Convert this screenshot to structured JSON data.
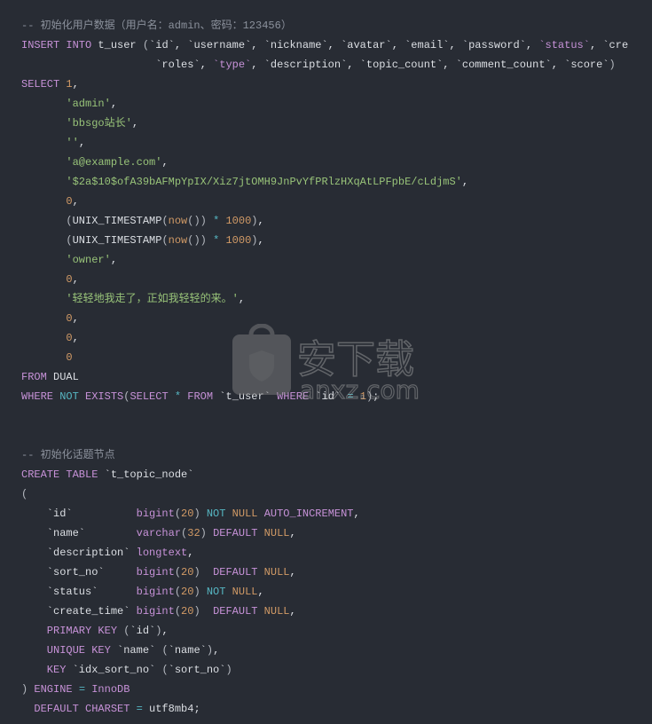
{
  "colors": {
    "background": "#282c34",
    "keyword": "#c792d8",
    "string": "#98c379",
    "number": "#d19a66",
    "operator": "#56b6c2",
    "comment": "#8b919c",
    "text": "#dcdfe4"
  },
  "watermark": {
    "text": "安下载",
    "domain": "anxz.com",
    "glyph": "安"
  },
  "lines": [
    [
      [
        "cm",
        "-- 初始化用户数据（用户名：admin、密码：123456）"
      ]
    ],
    [
      [
        "kw",
        "INSERT INTO "
      ],
      [
        "id",
        "t_user "
      ],
      [
        "pn",
        "("
      ],
      [
        "id",
        "`id`, `username`, `nickname`, `avatar`, `email`, `password`, "
      ],
      [
        "kw",
        "`status`"
      ],
      [
        "id",
        ", `cre"
      ]
    ],
    [
      [
        "id",
        "                     `roles`, "
      ],
      [
        "kw",
        "`type`"
      ],
      [
        "id",
        ", `description`, `topic_count`, `comment_count`, `score`"
      ],
      [
        "pn",
        ")"
      ]
    ],
    [
      [
        "kw",
        "SELECT "
      ],
      [
        "num",
        "1"
      ],
      [
        "id",
        ","
      ]
    ],
    [
      [
        "str",
        "       'admin'"
      ],
      [
        "id",
        ","
      ]
    ],
    [
      [
        "str",
        "       'bbsgo站长'"
      ],
      [
        "id",
        ","
      ]
    ],
    [
      [
        "str",
        "       ''"
      ],
      [
        "id",
        ","
      ]
    ],
    [
      [
        "str",
        "       'a@example.com'"
      ],
      [
        "id",
        ","
      ]
    ],
    [
      [
        "str",
        "       '$2a$10$ofA39bAFMpYpIX/Xiz7jtOMH9JnPvYfPRlzHXqAtLPFpbE/cLdjmS'"
      ],
      [
        "id",
        ","
      ]
    ],
    [
      [
        "num",
        "       0"
      ],
      [
        "id",
        ","
      ]
    ],
    [
      [
        "pn",
        "       ("
      ],
      [
        "id",
        "UNIX_TIMESTAMP"
      ],
      [
        "pn",
        "("
      ],
      [
        "num",
        "now"
      ],
      [
        "pn",
        "()) "
      ],
      [
        "op",
        "* "
      ],
      [
        "num",
        "1000"
      ],
      [
        "pn",
        ")"
      ],
      [
        "id",
        ","
      ]
    ],
    [
      [
        "pn",
        "       ("
      ],
      [
        "id",
        "UNIX_TIMESTAMP"
      ],
      [
        "pn",
        "("
      ],
      [
        "num",
        "now"
      ],
      [
        "pn",
        "()) "
      ],
      [
        "op",
        "* "
      ],
      [
        "num",
        "1000"
      ],
      [
        "pn",
        ")"
      ],
      [
        "id",
        ","
      ]
    ],
    [
      [
        "str",
        "       'owner'"
      ],
      [
        "id",
        ","
      ]
    ],
    [
      [
        "num",
        "       0"
      ],
      [
        "id",
        ","
      ]
    ],
    [
      [
        "str",
        "       '轻轻地我走了，正如我轻轻的来。'"
      ],
      [
        "id",
        ","
      ]
    ],
    [
      [
        "num",
        "       0"
      ],
      [
        "id",
        ","
      ]
    ],
    [
      [
        "num",
        "       0"
      ],
      [
        "id",
        ","
      ]
    ],
    [
      [
        "num",
        "       0"
      ]
    ],
    [
      [
        "kw",
        "FROM "
      ],
      [
        "id",
        "DUAL"
      ]
    ],
    [
      [
        "kw",
        "WHERE "
      ],
      [
        "op",
        "NOT "
      ],
      [
        "kw",
        "EXISTS"
      ],
      [
        "pn",
        "("
      ],
      [
        "kw",
        "SELECT "
      ],
      [
        "op",
        "* "
      ],
      [
        "kw",
        "FROM "
      ],
      [
        "id",
        "`t_user` "
      ],
      [
        "kw",
        "WHERE "
      ],
      [
        "id",
        "`id` "
      ],
      [
        "op",
        "= "
      ],
      [
        "num",
        "1"
      ],
      [
        "pn",
        ")"
      ],
      [
        "id",
        ";"
      ]
    ],
    [],
    [],
    [
      [
        "cm",
        "-- 初始化话题节点"
      ]
    ],
    [
      [
        "kw",
        "CREATE TABLE "
      ],
      [
        "id",
        "`t_topic_node`"
      ]
    ],
    [
      [
        "pn",
        "("
      ]
    ],
    [
      [
        "id",
        "    `id`          "
      ],
      [
        "kw",
        "bigint"
      ],
      [
        "pn",
        "("
      ],
      [
        "num",
        "20"
      ],
      [
        "pn",
        ") "
      ],
      [
        "op",
        "NOT "
      ],
      [
        "num",
        "NULL "
      ],
      [
        "kw",
        "AUTO_INCREMENT"
      ],
      [
        "id",
        ","
      ]
    ],
    [
      [
        "id",
        "    `name`        "
      ],
      [
        "kw",
        "varchar"
      ],
      [
        "pn",
        "("
      ],
      [
        "num",
        "32"
      ],
      [
        "pn",
        ") "
      ],
      [
        "kw",
        "DEFAULT "
      ],
      [
        "num",
        "NULL"
      ],
      [
        "id",
        ","
      ]
    ],
    [
      [
        "id",
        "    `description` "
      ],
      [
        "kw",
        "longtext"
      ],
      [
        "id",
        ","
      ]
    ],
    [
      [
        "id",
        "    `sort_no`     "
      ],
      [
        "kw",
        "bigint"
      ],
      [
        "pn",
        "("
      ],
      [
        "num",
        "20"
      ],
      [
        "pn",
        ")  "
      ],
      [
        "kw",
        "DEFAULT "
      ],
      [
        "num",
        "NULL"
      ],
      [
        "id",
        ","
      ]
    ],
    [
      [
        "id",
        "    `status`      "
      ],
      [
        "kw",
        "bigint"
      ],
      [
        "pn",
        "("
      ],
      [
        "num",
        "20"
      ],
      [
        "pn",
        ") "
      ],
      [
        "op",
        "NOT "
      ],
      [
        "num",
        "NULL"
      ],
      [
        "id",
        ","
      ]
    ],
    [
      [
        "id",
        "    `create_time` "
      ],
      [
        "kw",
        "bigint"
      ],
      [
        "pn",
        "("
      ],
      [
        "num",
        "20"
      ],
      [
        "pn",
        ")  "
      ],
      [
        "kw",
        "DEFAULT "
      ],
      [
        "num",
        "NULL"
      ],
      [
        "id",
        ","
      ]
    ],
    [
      [
        "kw",
        "    PRIMARY KEY "
      ],
      [
        "pn",
        "("
      ],
      [
        "id",
        "`id`"
      ],
      [
        "pn",
        ")"
      ],
      [
        "id",
        ","
      ]
    ],
    [
      [
        "kw",
        "    UNIQUE KEY "
      ],
      [
        "id",
        "`name` "
      ],
      [
        "pn",
        "("
      ],
      [
        "id",
        "`name`"
      ],
      [
        "pn",
        ")"
      ],
      [
        "id",
        ","
      ]
    ],
    [
      [
        "kw",
        "    KEY "
      ],
      [
        "id",
        "`idx_sort_no` "
      ],
      [
        "pn",
        "("
      ],
      [
        "id",
        "`sort_no`"
      ],
      [
        "pn",
        ")"
      ]
    ],
    [
      [
        "pn",
        ") "
      ],
      [
        "kw",
        "ENGINE "
      ],
      [
        "op",
        "= "
      ],
      [
        "kw",
        "InnoDB"
      ]
    ],
    [
      [
        "kw",
        "  DEFAULT CHARSET "
      ],
      [
        "op",
        "= "
      ],
      [
        "id",
        "utf8mb4;"
      ]
    ]
  ]
}
